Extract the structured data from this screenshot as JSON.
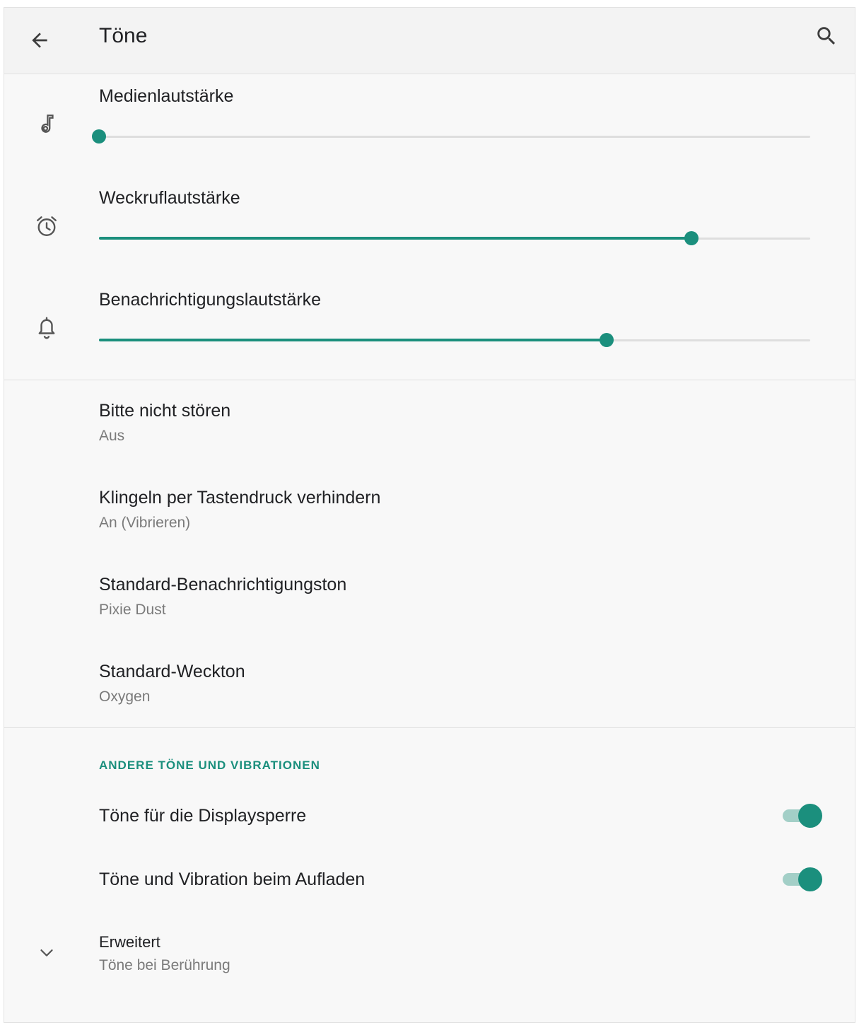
{
  "appbar": {
    "title": "Töne",
    "back_icon": "arrow-back-icon",
    "search_icon": "search-icon"
  },
  "volumes": [
    {
      "label": "Medienlautstärke",
      "icon": "music-note-icon",
      "level": 0.0
    },
    {
      "label": "Weckruflautstärke",
      "icon": "alarm-icon",
      "level": 0.833
    },
    {
      "label": "Benachrichtigungslautstärke",
      "icon": "bell-icon",
      "level": 0.714
    }
  ],
  "preferences": [
    {
      "title": "Bitte nicht stören",
      "summary": "Aus"
    },
    {
      "title": "Klingeln per Tastendruck verhindern",
      "summary": "An (Vibrieren)"
    },
    {
      "title": "Standard-Benachrichtigungston",
      "summary": "Pixie Dust"
    },
    {
      "title": "Standard-Weckton",
      "summary": "Oxygen"
    }
  ],
  "other_section": {
    "header": "ANDERE TÖNE UND VIBRATIONEN",
    "switches": [
      {
        "title": "Töne für die Displaysperre",
        "on": true
      },
      {
        "title": "Töne und Vibration beim Aufladen",
        "on": true
      }
    ],
    "advanced": {
      "title": "Erweitert",
      "summary": "Töne bei Berührung",
      "icon": "chevron-down-icon"
    }
  },
  "colors": {
    "accent": "#1b8f7d",
    "accent_light": "#a3cfc7",
    "track": "#dedede",
    "background": "#f8f8f8"
  }
}
